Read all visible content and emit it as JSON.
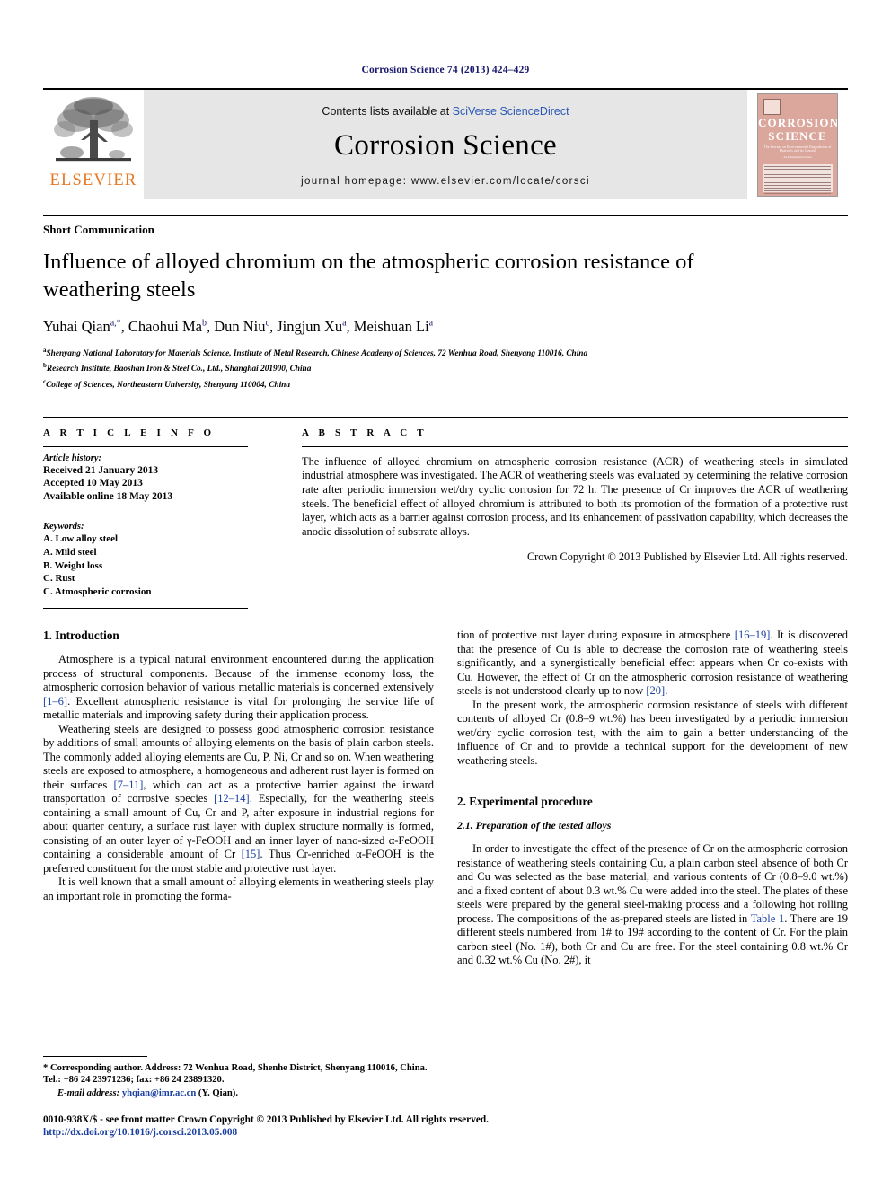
{
  "running_head": "Corrosion Science 74 (2013) 424–429",
  "masthead": {
    "contents_prefix": "Contents lists available at ",
    "sciencedirect": "SciVerse ScienceDirect",
    "journal_name": "Corrosion Science",
    "homepage": "journal homepage: www.elsevier.com/locate/corsci",
    "publisher_logo_text": "ELSEVIER",
    "cover": {
      "title_line1": "CORROSION",
      "title_line2": "SCIENCE",
      "subtitle": "The Journal on Environmental Degradation of Materials and its Control",
      "subtitle2": "An International Journal"
    },
    "link_color": "#2b57b5"
  },
  "article": {
    "type": "Short Communication",
    "title": "Influence of alloyed chromium on the atmospheric corrosion resistance of weathering steels",
    "authors": [
      {
        "name": "Yuhai Qian",
        "sup": "a,*"
      },
      {
        "name": "Chaohui Ma",
        "sup": "b"
      },
      {
        "name": "Dun Niu",
        "sup": "c"
      },
      {
        "name": "Jingjun Xu",
        "sup": "a"
      },
      {
        "name": "Meishuan Li",
        "sup": "a"
      }
    ],
    "affiliations": [
      {
        "sup": "a",
        "text": "Shenyang National Laboratory for Materials Science, Institute of Metal Research, Chinese Academy of Sciences, 72 Wenhua Road, Shenyang 110016, China"
      },
      {
        "sup": "b",
        "text": "Research Institute, Baoshan Iron & Steel Co., Ltd., Shanghai 201900, China"
      },
      {
        "sup": "c",
        "text": "College of Sciences, Northeastern University, Shenyang 110004, China"
      }
    ]
  },
  "info": {
    "heading": "A R T I C L E   I N F O",
    "history_label": "Article history:",
    "history": [
      "Received 21 January 2013",
      "Accepted 10 May 2013",
      "Available online 18 May 2013"
    ],
    "keywords_label": "Keywords:",
    "keywords": [
      "A. Low alloy steel",
      "A. Mild steel",
      "B. Weight loss",
      "C. Rust",
      "C. Atmospheric corrosion"
    ]
  },
  "abstract": {
    "heading": "A B S T R A C T",
    "text": "The influence of alloyed chromium on atmospheric corrosion resistance (ACR) of weathering steels in simulated industrial atmosphere was investigated. The ACR of weathering steels was evaluated by determining the relative corrosion rate after periodic immersion wet/dry cyclic corrosion for 72 h. The presence of Cr improves the ACR of weathering steels. The beneficial effect of alloyed chromium is attributed to both its promotion of the formation of a protective rust layer, which acts as a barrier against corrosion process, and its enhancement of passivation capability, which decreases the anodic dissolution of substrate alloys.",
    "copyright": "Crown Copyright © 2013 Published by Elsevier Ltd. All rights reserved."
  },
  "body": {
    "intro_heading": "1. Introduction",
    "intro_p1_a": "Atmosphere is a typical natural environment encountered during the application process of structural components. Because of the immense economy loss, the atmospheric corrosion behavior of various metallic materials is concerned extensively ",
    "intro_p1_cite1": "[1–6]",
    "intro_p1_b": ". Excellent atmospheric resistance is vital for prolonging the service life of metallic materials and improving safety during their application process.",
    "intro_p2_a": "Weathering steels are designed to possess good atmospheric corrosion resistance by additions of small amounts of alloying elements on the basis of plain carbon steels. The commonly added alloying elements are Cu, P, Ni, Cr and so on. When weathering steels are exposed to atmosphere, a homogeneous and adherent rust layer is formed on their surfaces ",
    "intro_p2_cite1": "[7–11]",
    "intro_p2_b": ", which can act as a protective barrier against the inward transportation of corrosive species ",
    "intro_p2_cite2": "[12–14]",
    "intro_p2_c": ". Especially, for the weathering steels containing a small amount of Cu, Cr and P, after exposure in industrial regions for about quarter century, a surface rust layer with duplex structure normally is formed, consisting of an outer layer of γ-FeOOH and an inner layer of nano-sized α-FeOOH containing a considerable amount of Cr ",
    "intro_p2_cite3": "[15]",
    "intro_p2_d": ". Thus Cr-enriched α-FeOOH is the preferred constituent for the most stable and protective rust layer.",
    "intro_p3": "It is well known that a small amount of alloying elements in weathering steels play an important role in promoting the forma-",
    "right_p1_a": "tion of protective rust layer during exposure in atmosphere ",
    "right_p1_cite1": "[16–19]",
    "right_p1_b": ". It is discovered that the presence of Cu is able to decrease the corrosion rate of weathering steels significantly, and a synergistically beneficial effect appears when Cr co-exists with Cu. However, the effect of Cr on the atmospheric corrosion resistance of weathering steels is not understood clearly up to now ",
    "right_p1_cite2": "[20]",
    "right_p1_c": ".",
    "right_p2": "In the present work, the atmospheric corrosion resistance of steels with different contents of alloyed Cr (0.8–9 wt.%) has been investigated by a periodic immersion wet/dry cyclic corrosion test, with the aim to gain a better understanding of the influence of Cr and to provide a technical support for the development of new weathering steels.",
    "exp_heading": "2. Experimental procedure",
    "exp_subheading": "2.1. Preparation of the tested alloys",
    "exp_p1_a": "In order to investigate the effect of the presence of Cr on the atmospheric corrosion resistance of weathering steels containing Cu, a plain carbon steel absence of both Cr and Cu was selected as the base material, and various contents of Cr (0.8–9.0 wt.%) and a fixed content of about 0.3 wt.% Cu were added into the steel. The plates of these steels were prepared by the general steel-making process and a following hot rolling process. The compositions of the as-prepared steels are listed in ",
    "exp_p1_link": "Table 1",
    "exp_p1_b": ". There are 19 different steels numbered from 1# to 19# according to the content of Cr. For the plain carbon steel (No. 1#), both Cr and Cu are free. For the steel containing 0.8 wt.% Cr and 0.32 wt.% Cu (No. 2#), it"
  },
  "footnote": {
    "corresponding": "* Corresponding author. Address: 72 Wenhua Road, Shenhe District, Shenyang 110016, China. Tel.: +86 24 23971236; fax: +86 24 23891320.",
    "email_label": "E-mail address:",
    "email": "yhqian@imr.ac.cn",
    "email_suffix": "(Y. Qian)."
  },
  "bottom": {
    "issn_line": "0010-938X/$ - see front matter Crown Copyright © 2013 Published by Elsevier Ltd. All rights reserved.",
    "doi": "http://dx.doi.org/10.1016/j.corsci.2013.05.008"
  }
}
